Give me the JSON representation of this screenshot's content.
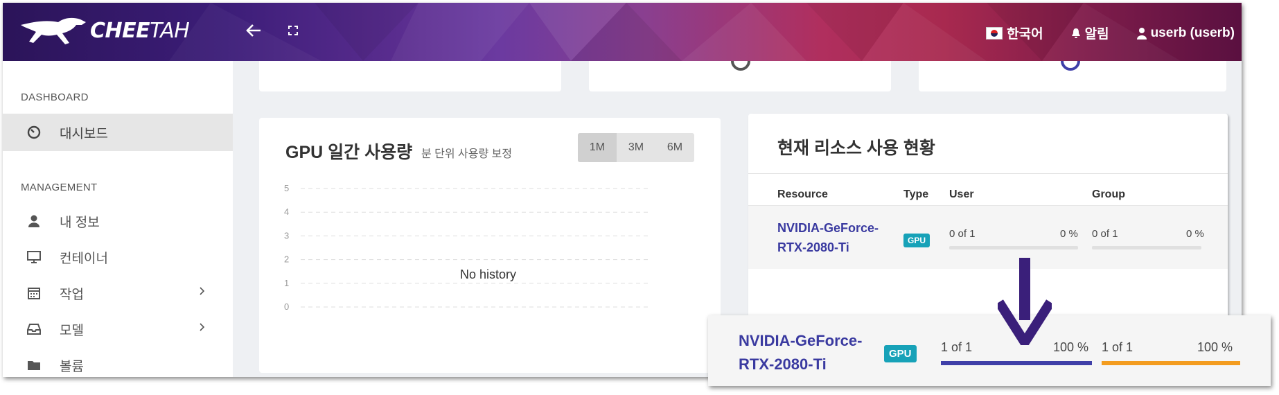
{
  "header": {
    "logo_text_bold": "CHEE",
    "logo_text_thin": "TAH",
    "language": "한국어",
    "notifications": "알림",
    "user": "userb (userb)"
  },
  "sidebar": {
    "section_dashboard": "DASHBOARD",
    "dashboard_item": "대시보드",
    "section_management": "MANAGEMENT",
    "items": [
      {
        "label": "내 정보",
        "icon": "user-icon"
      },
      {
        "label": "컨테이너",
        "icon": "monitor-icon"
      },
      {
        "label": "작업",
        "icon": "calendar-icon"
      },
      {
        "label": "모델",
        "icon": "inbox-icon"
      },
      {
        "label": "볼륨",
        "icon": "folder-icon"
      }
    ]
  },
  "gpu_card": {
    "title": "GPU 일간 사용량",
    "subtitle": "분 단위 사용량 보정",
    "ranges": [
      "1M",
      "3M",
      "6M"
    ],
    "selected_range": "1M",
    "no_history": "No history"
  },
  "chart_data": {
    "type": "line",
    "title": "GPU 일간 사용량",
    "y_ticks": [
      "5",
      "4",
      "3",
      "2",
      "1",
      "0"
    ],
    "ylim": [
      0,
      5
    ],
    "series": [],
    "grid": true
  },
  "resource_card": {
    "title": "현재 리소스 사용 현황",
    "headers": {
      "resource": "Resource",
      "type": "Type",
      "user": "User",
      "group": "Group"
    },
    "row": {
      "name_line1": "NVIDIA-GeForce-",
      "name_line2": "RTX-2080-Ti",
      "type": "GPU",
      "user_usage": "0 of 1",
      "user_percent": "0 %",
      "user_fraction": 0,
      "group_usage": "0 of 1",
      "group_percent": "0 %",
      "group_fraction": 0
    }
  },
  "zoom_row": {
    "name_line1": "NVIDIA-GeForce-",
    "name_line2": "RTX-2080-Ti",
    "type": "GPU",
    "user_usage": "1 of 1",
    "user_percent": "100 %",
    "user_fraction": 1,
    "group_usage": "1 of 1",
    "group_percent": "100 %",
    "group_fraction": 1
  },
  "colors": {
    "user_bar": "#3f3fa8",
    "group_bar": "#f39c1f",
    "badge": "#17a2b8",
    "arrow": "#3a1f7a"
  }
}
